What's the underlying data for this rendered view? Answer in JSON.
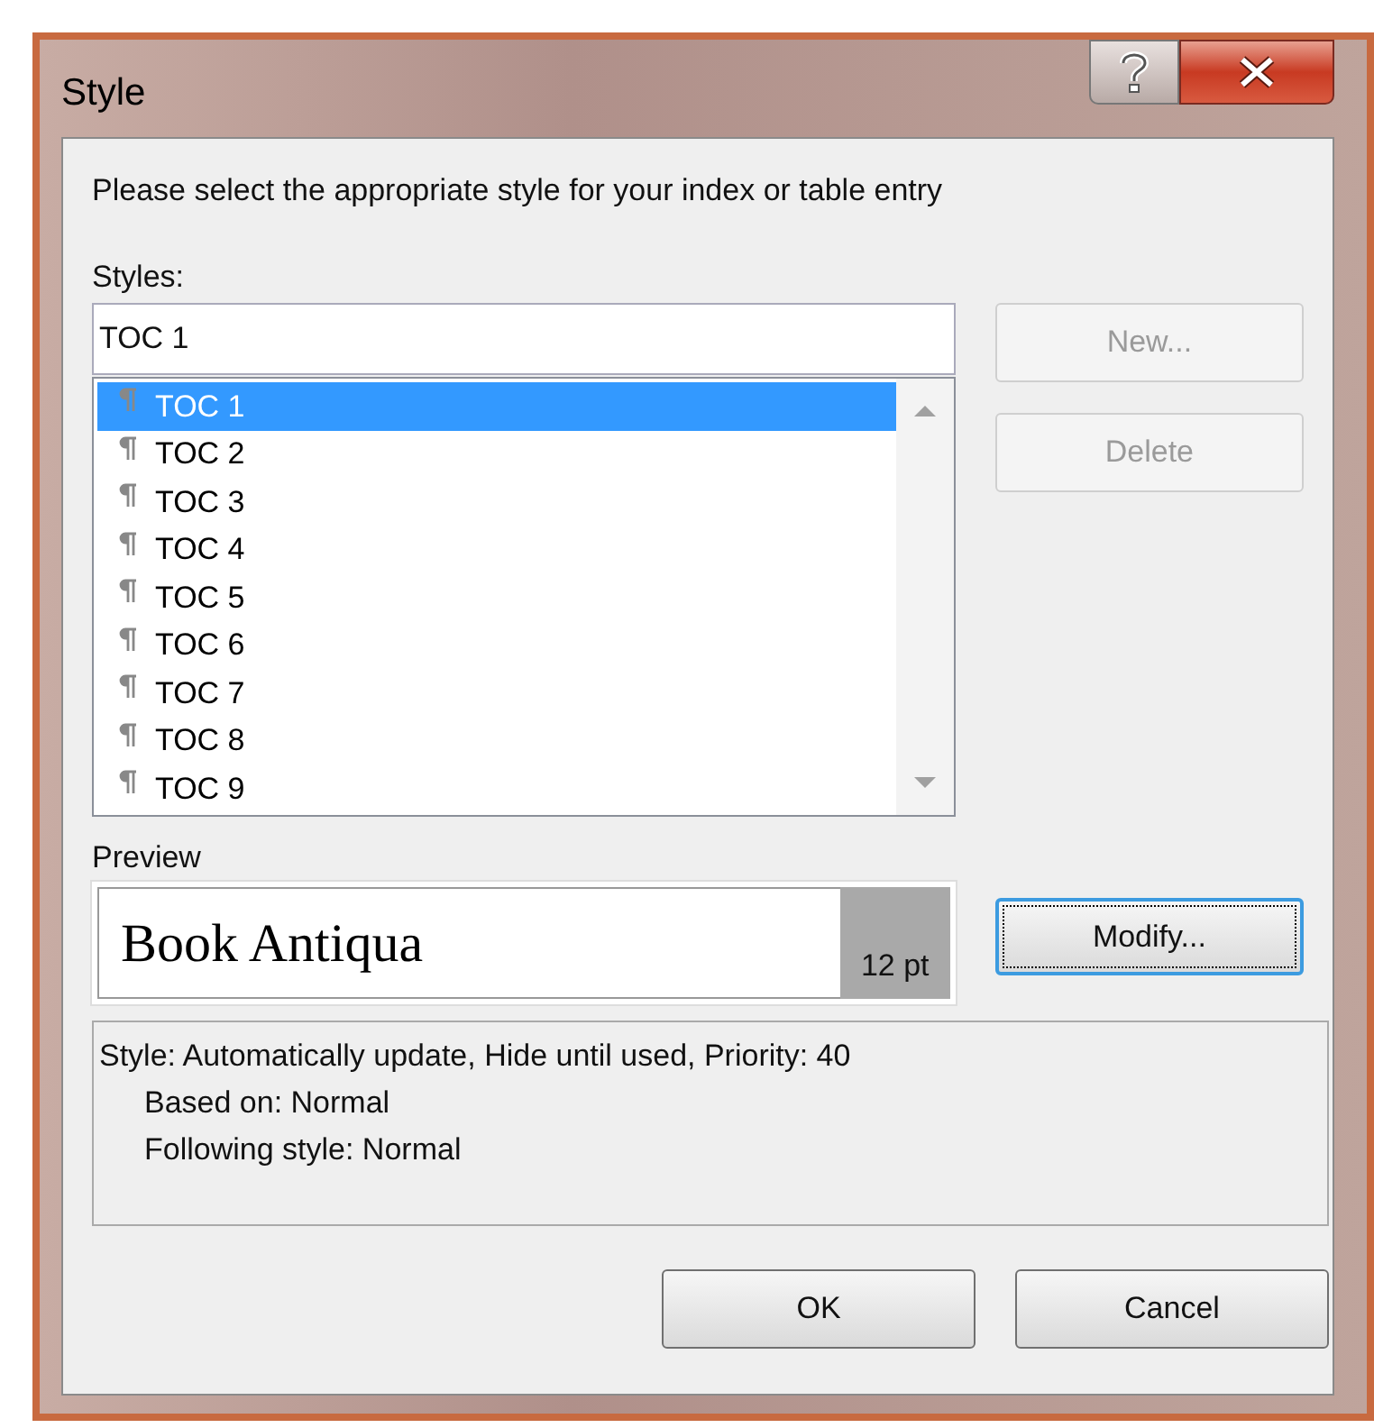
{
  "window": {
    "title": "Style"
  },
  "instruction": "Please select the appropriate style for your index or table entry",
  "styles": {
    "label": "Styles:",
    "value": "TOC 1",
    "items": [
      {
        "label": "TOC 1",
        "selected": true
      },
      {
        "label": "TOC 2",
        "selected": false
      },
      {
        "label": "TOC 3",
        "selected": false
      },
      {
        "label": "TOC 4",
        "selected": false
      },
      {
        "label": "TOC 5",
        "selected": false
      },
      {
        "label": "TOC 6",
        "selected": false
      },
      {
        "label": "TOC 7",
        "selected": false
      },
      {
        "label": "TOC 8",
        "selected": false
      },
      {
        "label": "TOC 9",
        "selected": false
      }
    ]
  },
  "side_buttons": [
    {
      "label": "New...",
      "disabled": true
    },
    {
      "label": "Delete",
      "disabled": true
    }
  ],
  "preview": {
    "label": "Preview",
    "font_name": "Book Antiqua",
    "size": "12 pt"
  },
  "modify_button": {
    "label": "Modify...",
    "focused": true
  },
  "description": {
    "summary": "Style: Automatically update, Hide until used, Priority: 40",
    "details": [
      "Based on: Normal",
      "Following style: Normal"
    ]
  },
  "buttons": [
    {
      "label": "OK"
    },
    {
      "label": "Cancel"
    }
  ]
}
